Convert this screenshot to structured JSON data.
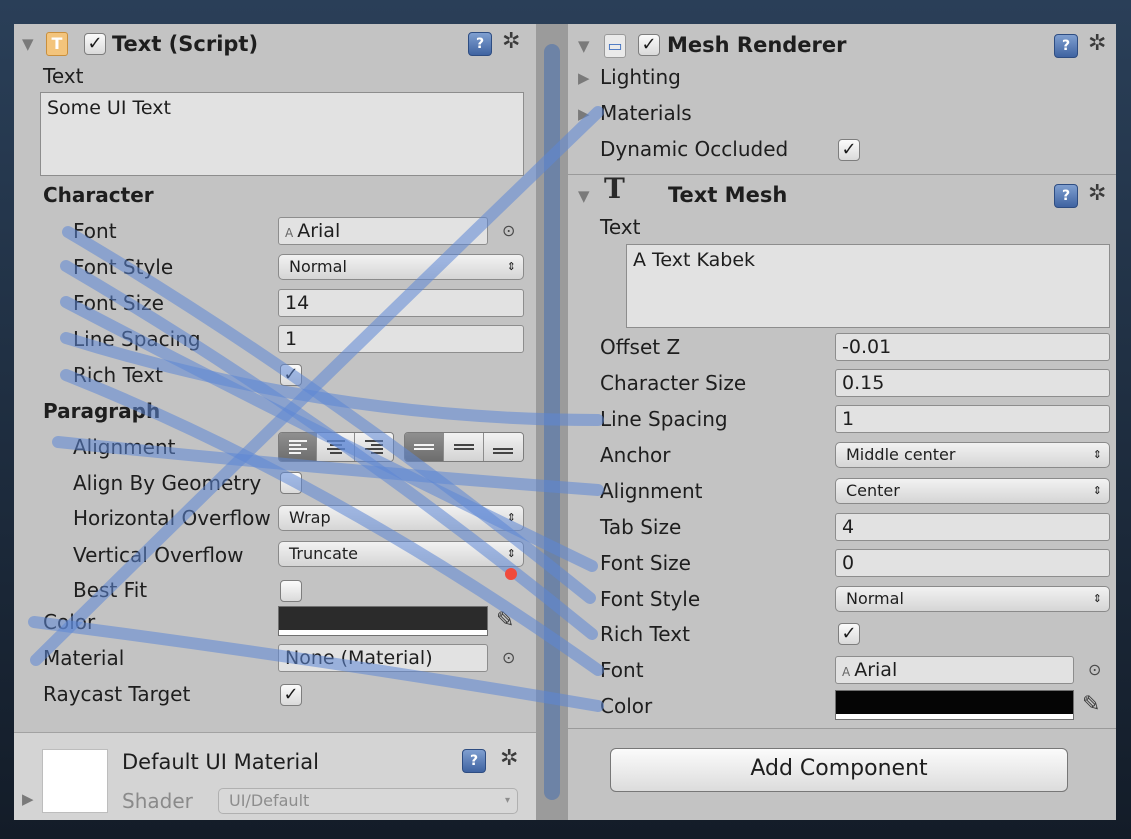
{
  "left": {
    "header": {
      "title": "Text (Script)",
      "icon": "T"
    },
    "text_label": "Text",
    "text_value": "Some UI Text",
    "character": {
      "heading": "Character",
      "font_label": "Font",
      "font_value": "Arial",
      "font_style_label": "Font Style",
      "font_style_value": "Normal",
      "font_size_label": "Font Size",
      "font_size_value": "14",
      "line_spacing_label": "Line Spacing",
      "line_spacing_value": "1",
      "rich_text_label": "Rich Text"
    },
    "paragraph": {
      "heading": "Paragraph",
      "alignment_label": "Alignment",
      "align_by_geometry_label": "Align By Geometry",
      "horizontal_overflow_label": "Horizontal Overflow",
      "horizontal_overflow_value": "Wrap",
      "vertical_overflow_label": "Vertical Overflow",
      "vertical_overflow_value": "Truncate",
      "best_fit_label": "Best Fit"
    },
    "color_label": "Color",
    "material_label": "Material",
    "material_value": "None (Material)",
    "raycast_label": "Raycast Target",
    "footer": {
      "title": "Default UI Material",
      "shader_label": "Shader",
      "shader_value": "UI/Default"
    }
  },
  "right": {
    "mesh_renderer": {
      "title": "Mesh Renderer",
      "lighting": "Lighting",
      "materials": "Materials",
      "dynamic_occluded": "Dynamic Occluded"
    },
    "text_mesh": {
      "title": "Text Mesh",
      "icon": "T",
      "text_label": "Text",
      "text_value": "A Text Kabek",
      "offset_z_label": "Offset Z",
      "offset_z_value": "-0.01",
      "character_size_label": "Character Size",
      "character_size_value": "0.15",
      "line_spacing_label": "Line Spacing",
      "line_spacing_value": "1",
      "anchor_label": "Anchor",
      "anchor_value": "Middle center",
      "alignment_label": "Alignment",
      "alignment_value": "Center",
      "tab_size_label": "Tab Size",
      "tab_size_value": "4",
      "font_size_label": "Font Size",
      "font_size_value": "0",
      "font_style_label": "Font Style",
      "font_style_value": "Normal",
      "rich_text_label": "Rich Text",
      "font_label": "Font",
      "font_value": "Arial",
      "color_label": "Color"
    },
    "add_component": "Add Component"
  },
  "glyphs": {
    "check": "✓",
    "help": "?",
    "gear": "✲",
    "expanded": "▼",
    "collapsed": "▶",
    "updown": "⇕",
    "picker": "⊙",
    "eyedropper": "✎",
    "font_asset": "A"
  },
  "colors": {
    "panel": "#c3c3c3",
    "field": "#e2e2e2",
    "left_color_value": "#2b2b2b",
    "right_color_value": "#050505",
    "annotation_stroke": "#5d86d6"
  }
}
